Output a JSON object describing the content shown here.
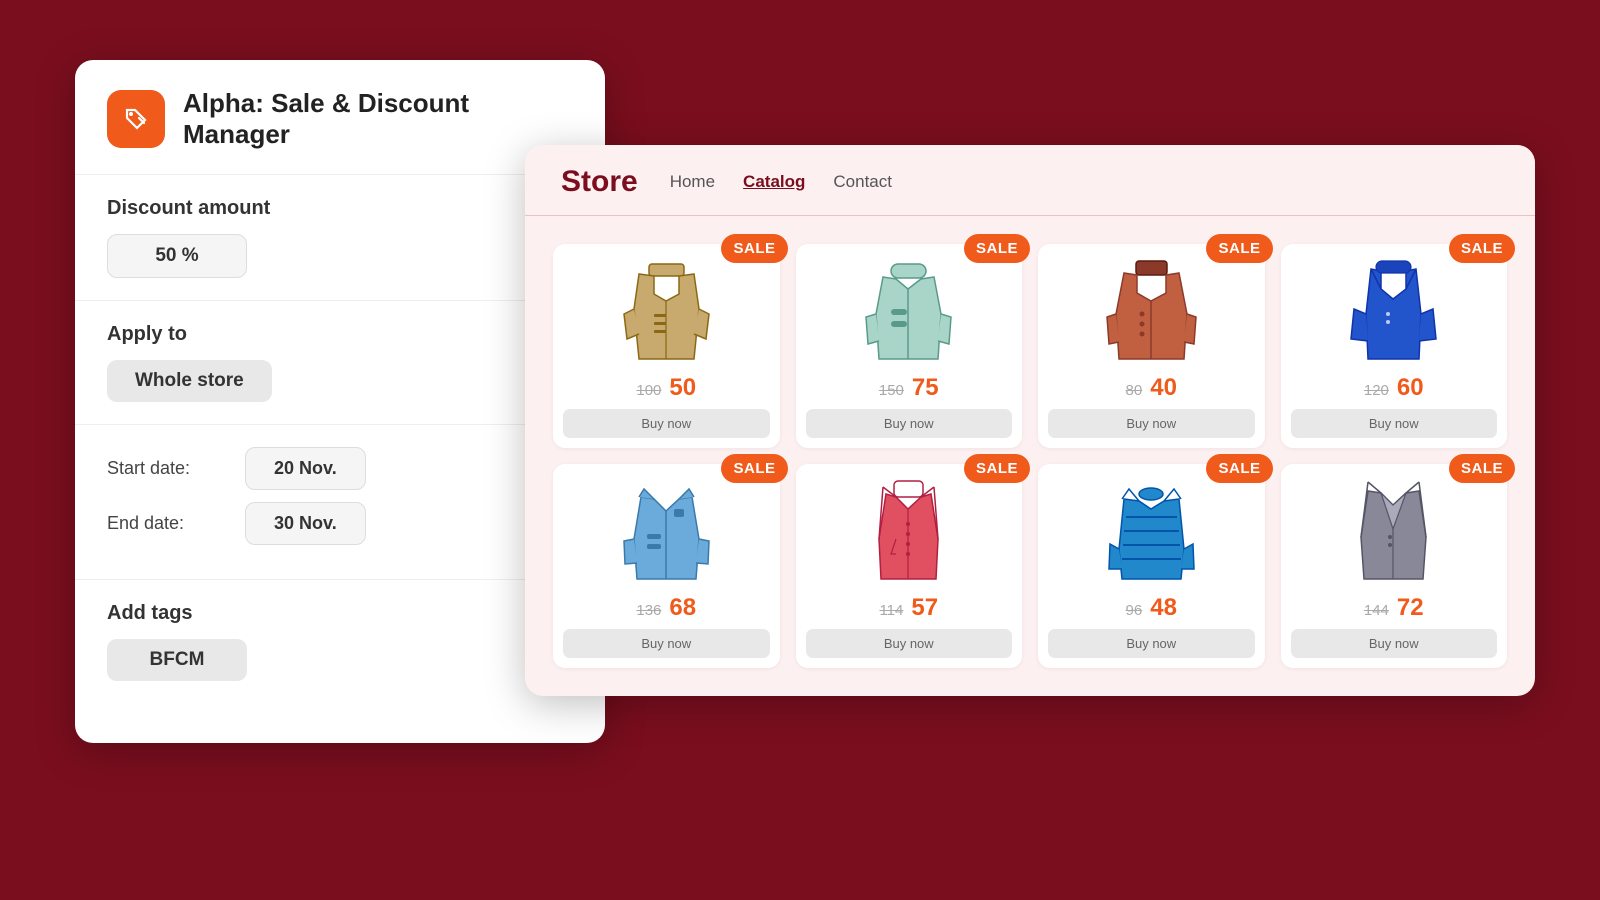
{
  "app": {
    "title": "Alpha: Sale & Discount Manager",
    "icon": "tag-icon"
  },
  "left_panel": {
    "discount_label": "Discount amount",
    "discount_value": "50 %",
    "apply_label": "Apply to",
    "apply_value": "Whole store",
    "start_label": "Start date:",
    "start_value": "20 Nov.",
    "end_label": "End date:",
    "end_value": "30 Nov.",
    "tags_label": "Add tags",
    "tags_value": "BFCM"
  },
  "store": {
    "title": "Store",
    "nav": [
      {
        "label": "Home",
        "active": false
      },
      {
        "label": "Catalog",
        "active": true
      },
      {
        "label": "Contact",
        "active": false
      }
    ]
  },
  "products": [
    {
      "name": "trench-coat",
      "original": "100",
      "sale": "50",
      "badge": "SALE"
    },
    {
      "name": "zip-jacket",
      "original": "150",
      "sale": "75",
      "badge": "SALE"
    },
    {
      "name": "brown-coat",
      "original": "80",
      "sale": "40",
      "badge": "SALE"
    },
    {
      "name": "blue-blazer",
      "original": "120",
      "sale": "60",
      "badge": "SALE"
    },
    {
      "name": "denim-jacket",
      "original": "136",
      "sale": "68",
      "badge": "SALE"
    },
    {
      "name": "red-shirt",
      "original": "114",
      "sale": "57",
      "badge": "SALE"
    },
    {
      "name": "puffer-jacket",
      "original": "96",
      "sale": "48",
      "badge": "SALE"
    },
    {
      "name": "grey-suit",
      "original": "144",
      "sale": "72",
      "badge": "SALE"
    }
  ],
  "buttons": {
    "buy_now": "Buy now"
  }
}
